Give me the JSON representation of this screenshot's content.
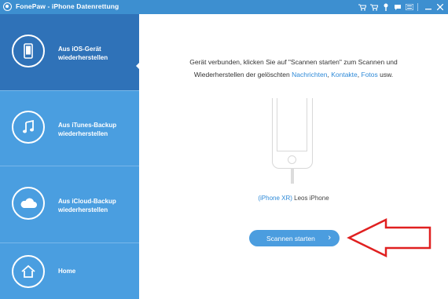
{
  "titlebar": {
    "app_title": "FonePaw - iPhone Datenrettung",
    "icons": [
      "cart-icon",
      "cart-icon-2",
      "key-icon",
      "chat-icon",
      "menu-icon",
      "minimize-icon",
      "close-icon"
    ]
  },
  "sidebar": {
    "items": [
      {
        "label": "Aus iOS-Gerät\nwiederherstellen",
        "icon": "phone-icon",
        "active": true
      },
      {
        "label": "Aus iTunes-Backup\nwiederherstellen",
        "icon": "music-note-icon",
        "active": false
      },
      {
        "label": "Aus iCloud-Backup\nwiederherstellen",
        "icon": "cloud-icon",
        "active": false
      },
      {
        "label": "Home",
        "icon": "home-icon",
        "active": false
      }
    ]
  },
  "main": {
    "instruction_line1": "Gerät verbunden, klicken Sie auf \"Scannen starten\" zum Scannen und",
    "instruction_line2_prefix": "Wiederherstellen der gelöschten ",
    "link_messages": "Nachrichten",
    "sep1": ", ",
    "link_contacts": "Kontakte",
    "sep2": ", ",
    "link_photos": "Fotos",
    "instruction_suffix": " usw.",
    "device_model": "(iPhone XR)",
    "device_name": " Leos iPhone",
    "scan_button": "Scannen starten",
    "scan_chevron": "›"
  },
  "colors": {
    "titlebar": "#3d8fd0",
    "sidebar": "#4a9ee0",
    "sidebar_active": "#2f72b8",
    "link": "#2e8ad8",
    "button": "#4b9ddf",
    "annotation_arrow": "#e02020"
  }
}
